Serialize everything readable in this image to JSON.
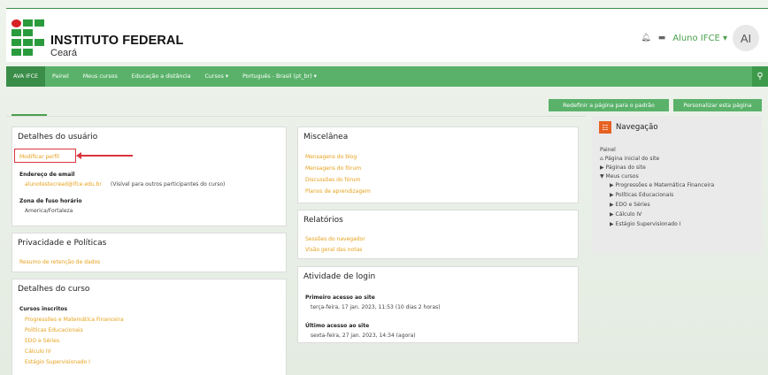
{
  "header": {
    "brand_line1": "INSTITUTO FEDERAL",
    "brand_line2": "Ceará",
    "bell_icon": "🔔",
    "chat_icon": "💬",
    "username": "Aluno IFCE ▾",
    "avatar_initials": "AI"
  },
  "navbar": {
    "items": [
      "AVA IFCE",
      "Painel",
      "Meus cursos",
      "Educação a distância",
      "Cursos ▾",
      "Português - Brasil (pt_br) ▾"
    ],
    "search_icon": "🔍"
  },
  "buttons": {
    "reset": "Redefinir a página para o padrão",
    "customize": "Personalizar esta página"
  },
  "user_details": {
    "title": "Detalhes do usuário",
    "edit_profile": "Modificar perfil",
    "email_label": "Endereço de email",
    "email_value": "alunotestecread@ifce.edu.br",
    "email_note": "(Visível para outros participantes do curso)",
    "timezone_label": "Zona de fuso horário",
    "timezone_value": "America/Fortaleza"
  },
  "privacy": {
    "title": "Privacidade e Políticas",
    "link": "Resumo de retenção de dados"
  },
  "course_details": {
    "title": "Detalhes do curso",
    "enrolled_label": "Cursos inscritos",
    "courses": [
      "Progressões e Matemática Financeira",
      "Políticas Educacionais",
      "EDO e Séries",
      "Cálculo IV",
      "Estágio Supervisionado I"
    ]
  },
  "misc": {
    "title": "Miscelânea",
    "links": [
      "Mensagens do blog",
      "Mensagens do fórum",
      "Discussões do fórum",
      "Planos de aprendizagem"
    ]
  },
  "reports": {
    "title": "Relatórios",
    "links": [
      "Sessões do navegador",
      "Visão geral das notas"
    ]
  },
  "login": {
    "title": "Atividade de login",
    "first_label": "Primeiro acesso ao site",
    "first_value": "terça-feira, 17 jan. 2023, 11:53  (10 dias 2 horas)",
    "last_label": "Último acesso ao site",
    "last_value": "sexta-feira, 27 jan. 2023, 14:34  (agora)"
  },
  "navigation": {
    "title": "Navegação",
    "icon": "sitemap",
    "painel": "Painel",
    "home": "Página inicial do site",
    "site_pages": "Páginas do site",
    "my_courses": "Meus cursos",
    "courses": [
      "Progressões e Matemática Financeira",
      "Políticas Educacionais",
      "EDO e Séries",
      "Cálculo IV",
      "Estágio Supervisionado I"
    ]
  }
}
